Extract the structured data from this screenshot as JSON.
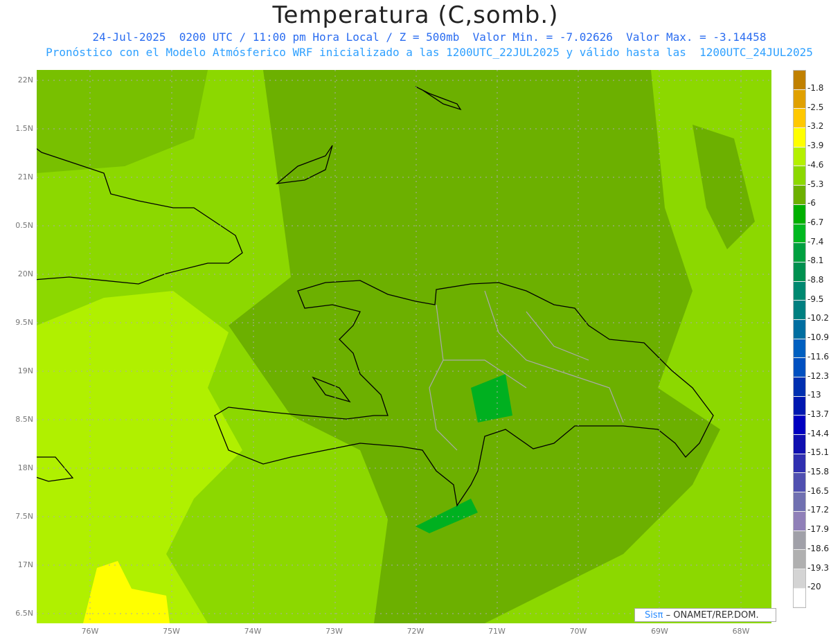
{
  "title": "Temperatura (C,somb.)",
  "subtitle1": "24-Jul-2025  0200 UTC / 11:00 pm Hora Local / Z = 500mb  Valor Min. = -7.02626  Valor Max. = -3.14458",
  "subtitle2": "Pronóstico con el Modelo Atmósferico WRF inicializado a las 1200UTC_22JUL2025 y válido hasta las  1200UTC_24JUL2025",
  "lat_labels": [
    "22N",
    "1.5N",
    "21N",
    "0.5N",
    "20N",
    "9.5N",
    "19N",
    "8.5N",
    "18N",
    "7.5N",
    "17N",
    "6.5N"
  ],
  "lon_labels": [
    "76W",
    "75W",
    "74W",
    "73W",
    "72W",
    "71W",
    "70W",
    "69W",
    "68W"
  ],
  "colorbar": {
    "colors": [
      "#c08000",
      "#e0a000",
      "#ffc800",
      "#ffff00",
      "#b4f000",
      "#8cd800",
      "#6cb000",
      "#00b000",
      "#00b820",
      "#00a040",
      "#009050",
      "#008870",
      "#007f80",
      "#006ea0",
      "#0060c0",
      "#0050c0",
      "#0030b0",
      "#0018b0",
      "#0000c0",
      "#1010b0",
      "#3030b0",
      "#5050b0",
      "#7070b0",
      "#9080b8",
      "#a0a0a8",
      "#b0b0b0",
      "#d4d4d4",
      "#ffffff"
    ],
    "labels": [
      "-1.8",
      "-2.5",
      "-3.2",
      "-3.9",
      "-4.6",
      "-5.3",
      "-6",
      "-6.7",
      "-7.4",
      "-8.1",
      "-8.8",
      "-9.5",
      "-10.2",
      "-10.9",
      "-11.6",
      "-12.3",
      "-13",
      "-13.7",
      "-14.4",
      "-15.1",
      "-15.8",
      "-16.5",
      "-17.2",
      "-17.9",
      "-18.6",
      "-19.3",
      "-20"
    ]
  },
  "logo": {
    "brand": "Sisπ",
    "text": "– ONAMET/REP.DOM."
  }
}
